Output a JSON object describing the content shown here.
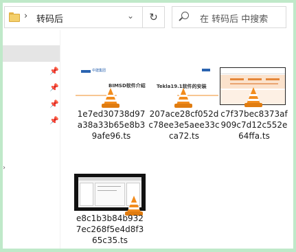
{
  "address_bar": {
    "breadcrumb_label": "转码后",
    "separator": "›",
    "dropdown_glyph": "⌄"
  },
  "refresh_glyph": "↻",
  "search": {
    "placeholder": "在 转码后 中搜索"
  },
  "files": [
    {
      "name": "1e7ed30738d97a38a33b65e8b39afe96.ts",
      "thumbnail_text": "BIMSD软件介绍",
      "thumbnail_logo": "中建集团"
    },
    {
      "name": "207ace28cf052dc78ee3e5aee33cca72.ts",
      "thumbnail_text": "Tekla19.1软件的安装",
      "thumbnail_logo": "中建集团"
    },
    {
      "name": "c7f37bec8373af909c7d12c552e64ffa.ts",
      "thumbnail_text": "",
      "thumbnail_logo": ""
    },
    {
      "name": "e8c1b3b84b9327ec268f5e4d8f365c35.ts",
      "thumbnail_text": "",
      "thumbnail_logo": ""
    }
  ],
  "colors": {
    "accent_orange": "#f28c1d",
    "selection_gray": "#e5e5e5",
    "background_green": "#bfe9c9"
  },
  "icons": [
    "folder-icon",
    "chevron-right-icon",
    "chevron-down-icon",
    "refresh-icon",
    "search-icon",
    "pin-icon",
    "vlc-cone-icon"
  ]
}
